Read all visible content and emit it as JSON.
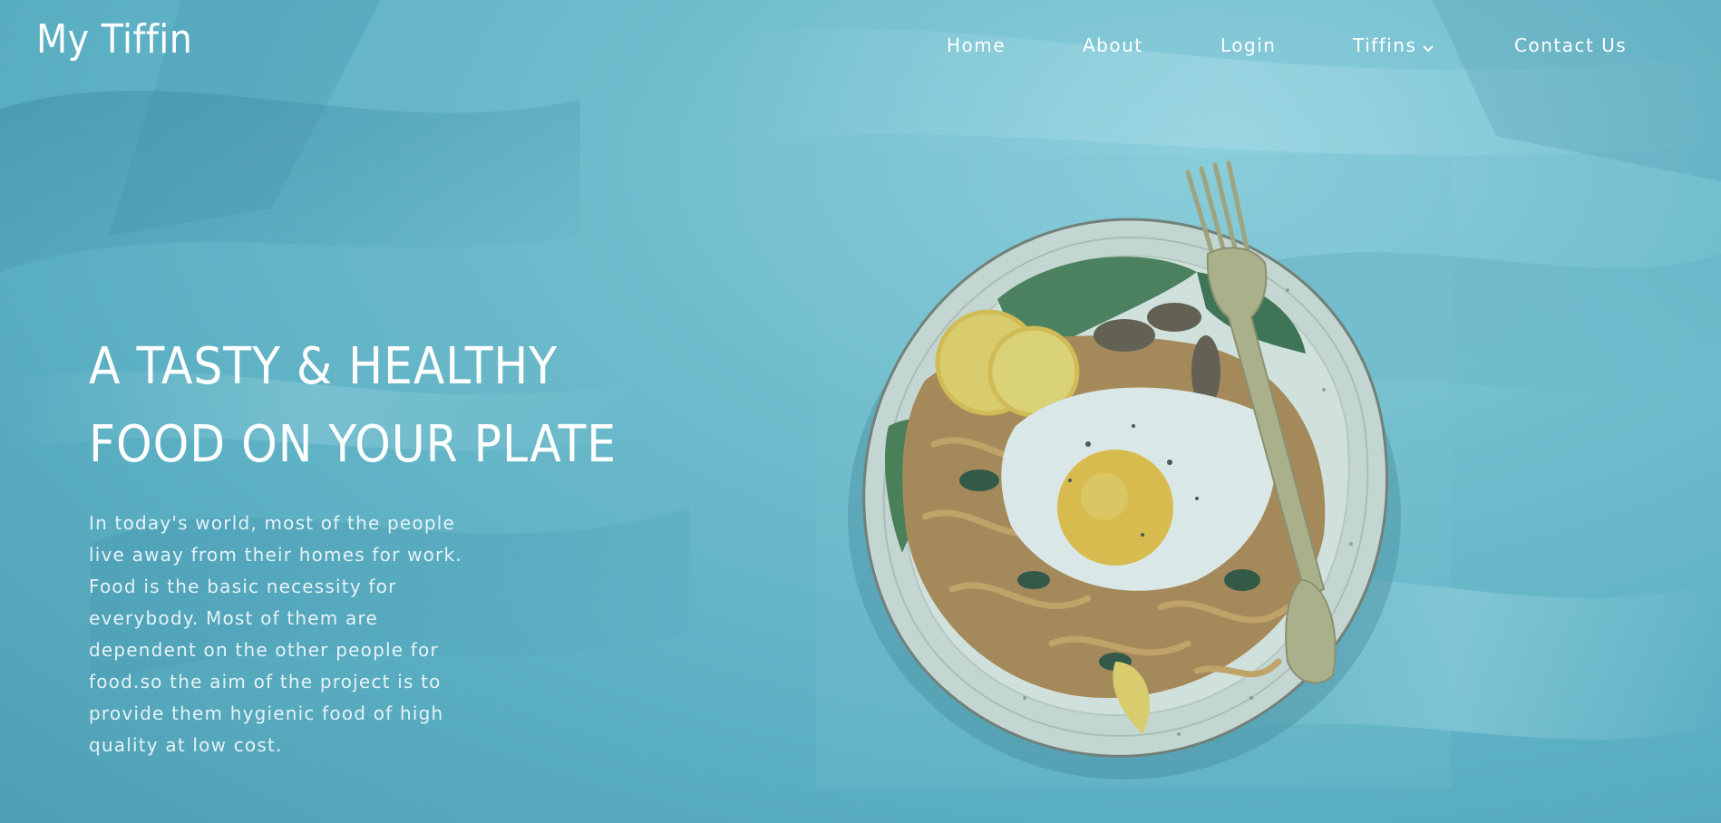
{
  "brand": {
    "name": "My Tiffin"
  },
  "nav": {
    "items": [
      {
        "label": "Home"
      },
      {
        "label": "About"
      },
      {
        "label": "Login"
      },
      {
        "label": "Tiffins",
        "icon": "chevron-down-icon"
      },
      {
        "label": "Contact Us"
      }
    ]
  },
  "hero": {
    "title_line1": "A TASTY & HEALTHY",
    "title_line2": "FOOD ON YOUR PLATE",
    "body": "In today's world, most of the people live away from their homes for work. Food is the basic necessity for everybody. Most of them are dependent on the other people for food.so the aim of the project is to provide them hygienic food of high quality at low cost."
  },
  "colors": {
    "background": "#6fbccd",
    "text": "#ffffff",
    "body_text": "#e6f3f6"
  }
}
